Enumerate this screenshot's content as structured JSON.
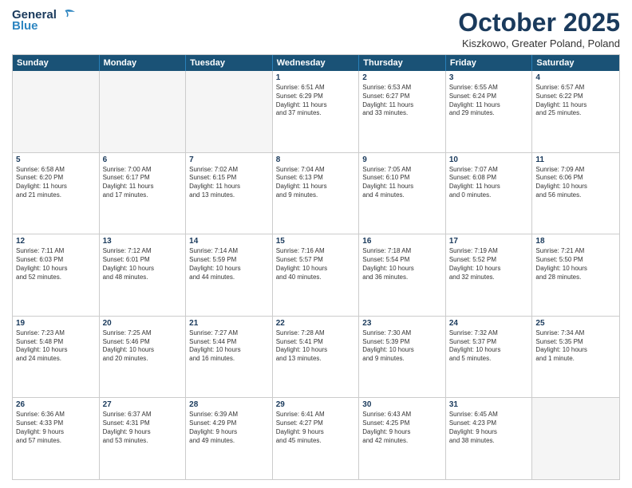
{
  "logo": {
    "text1": "General",
    "text2": "Blue"
  },
  "header": {
    "title": "October 2025",
    "subtitle": "Kiszkowo, Greater Poland, Poland"
  },
  "dayHeaders": [
    "Sunday",
    "Monday",
    "Tuesday",
    "Wednesday",
    "Thursday",
    "Friday",
    "Saturday"
  ],
  "weeks": [
    [
      {
        "day": "",
        "empty": true,
        "info": ""
      },
      {
        "day": "",
        "empty": true,
        "info": ""
      },
      {
        "day": "",
        "empty": true,
        "info": ""
      },
      {
        "day": "1",
        "empty": false,
        "info": "Sunrise: 6:51 AM\nSunset: 6:29 PM\nDaylight: 11 hours\nand 37 minutes."
      },
      {
        "day": "2",
        "empty": false,
        "info": "Sunrise: 6:53 AM\nSunset: 6:27 PM\nDaylight: 11 hours\nand 33 minutes."
      },
      {
        "day": "3",
        "empty": false,
        "info": "Sunrise: 6:55 AM\nSunset: 6:24 PM\nDaylight: 11 hours\nand 29 minutes."
      },
      {
        "day": "4",
        "empty": false,
        "info": "Sunrise: 6:57 AM\nSunset: 6:22 PM\nDaylight: 11 hours\nand 25 minutes."
      }
    ],
    [
      {
        "day": "5",
        "empty": false,
        "info": "Sunrise: 6:58 AM\nSunset: 6:20 PM\nDaylight: 11 hours\nand 21 minutes."
      },
      {
        "day": "6",
        "empty": false,
        "info": "Sunrise: 7:00 AM\nSunset: 6:17 PM\nDaylight: 11 hours\nand 17 minutes."
      },
      {
        "day": "7",
        "empty": false,
        "info": "Sunrise: 7:02 AM\nSunset: 6:15 PM\nDaylight: 11 hours\nand 13 minutes."
      },
      {
        "day": "8",
        "empty": false,
        "info": "Sunrise: 7:04 AM\nSunset: 6:13 PM\nDaylight: 11 hours\nand 9 minutes."
      },
      {
        "day": "9",
        "empty": false,
        "info": "Sunrise: 7:05 AM\nSunset: 6:10 PM\nDaylight: 11 hours\nand 4 minutes."
      },
      {
        "day": "10",
        "empty": false,
        "info": "Sunrise: 7:07 AM\nSunset: 6:08 PM\nDaylight: 11 hours\nand 0 minutes."
      },
      {
        "day": "11",
        "empty": false,
        "info": "Sunrise: 7:09 AM\nSunset: 6:06 PM\nDaylight: 10 hours\nand 56 minutes."
      }
    ],
    [
      {
        "day": "12",
        "empty": false,
        "info": "Sunrise: 7:11 AM\nSunset: 6:03 PM\nDaylight: 10 hours\nand 52 minutes."
      },
      {
        "day": "13",
        "empty": false,
        "info": "Sunrise: 7:12 AM\nSunset: 6:01 PM\nDaylight: 10 hours\nand 48 minutes."
      },
      {
        "day": "14",
        "empty": false,
        "info": "Sunrise: 7:14 AM\nSunset: 5:59 PM\nDaylight: 10 hours\nand 44 minutes."
      },
      {
        "day": "15",
        "empty": false,
        "info": "Sunrise: 7:16 AM\nSunset: 5:57 PM\nDaylight: 10 hours\nand 40 minutes."
      },
      {
        "day": "16",
        "empty": false,
        "info": "Sunrise: 7:18 AM\nSunset: 5:54 PM\nDaylight: 10 hours\nand 36 minutes."
      },
      {
        "day": "17",
        "empty": false,
        "info": "Sunrise: 7:19 AM\nSunset: 5:52 PM\nDaylight: 10 hours\nand 32 minutes."
      },
      {
        "day": "18",
        "empty": false,
        "info": "Sunrise: 7:21 AM\nSunset: 5:50 PM\nDaylight: 10 hours\nand 28 minutes."
      }
    ],
    [
      {
        "day": "19",
        "empty": false,
        "info": "Sunrise: 7:23 AM\nSunset: 5:48 PM\nDaylight: 10 hours\nand 24 minutes."
      },
      {
        "day": "20",
        "empty": false,
        "info": "Sunrise: 7:25 AM\nSunset: 5:46 PM\nDaylight: 10 hours\nand 20 minutes."
      },
      {
        "day": "21",
        "empty": false,
        "info": "Sunrise: 7:27 AM\nSunset: 5:44 PM\nDaylight: 10 hours\nand 16 minutes."
      },
      {
        "day": "22",
        "empty": false,
        "info": "Sunrise: 7:28 AM\nSunset: 5:41 PM\nDaylight: 10 hours\nand 13 minutes."
      },
      {
        "day": "23",
        "empty": false,
        "info": "Sunrise: 7:30 AM\nSunset: 5:39 PM\nDaylight: 10 hours\nand 9 minutes."
      },
      {
        "day": "24",
        "empty": false,
        "info": "Sunrise: 7:32 AM\nSunset: 5:37 PM\nDaylight: 10 hours\nand 5 minutes."
      },
      {
        "day": "25",
        "empty": false,
        "info": "Sunrise: 7:34 AM\nSunset: 5:35 PM\nDaylight: 10 hours\nand 1 minute."
      }
    ],
    [
      {
        "day": "26",
        "empty": false,
        "info": "Sunrise: 6:36 AM\nSunset: 4:33 PM\nDaylight: 9 hours\nand 57 minutes."
      },
      {
        "day": "27",
        "empty": false,
        "info": "Sunrise: 6:37 AM\nSunset: 4:31 PM\nDaylight: 9 hours\nand 53 minutes."
      },
      {
        "day": "28",
        "empty": false,
        "info": "Sunrise: 6:39 AM\nSunset: 4:29 PM\nDaylight: 9 hours\nand 49 minutes."
      },
      {
        "day": "29",
        "empty": false,
        "info": "Sunrise: 6:41 AM\nSunset: 4:27 PM\nDaylight: 9 hours\nand 45 minutes."
      },
      {
        "day": "30",
        "empty": false,
        "info": "Sunrise: 6:43 AM\nSunset: 4:25 PM\nDaylight: 9 hours\nand 42 minutes."
      },
      {
        "day": "31",
        "empty": false,
        "info": "Sunrise: 6:45 AM\nSunset: 4:23 PM\nDaylight: 9 hours\nand 38 minutes."
      },
      {
        "day": "",
        "empty": true,
        "info": ""
      }
    ]
  ]
}
